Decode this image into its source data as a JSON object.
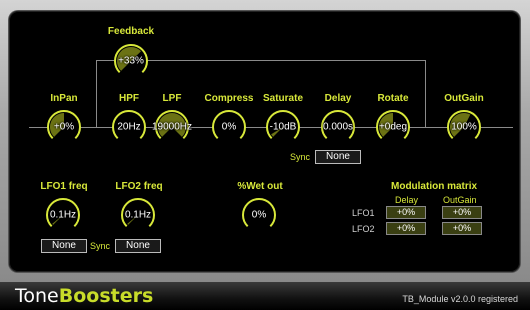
{
  "colors": {
    "accent": "#d8e83a",
    "knob_fill": "#6b7214",
    "knob_body": "#000000"
  },
  "knobs": {
    "feedback": {
      "label": "Feedback",
      "value": "+33%",
      "level": 0.67
    },
    "inpan": {
      "label": "InPan",
      "value": "+0%",
      "level": 0.5
    },
    "hpf": {
      "label": "HPF",
      "value": "20Hz",
      "level": 0.0
    },
    "lpf": {
      "label": "LPF",
      "value": "19000Hz",
      "level": 1.0
    },
    "compress": {
      "label": "Compress",
      "value": "0%",
      "level": 0.0
    },
    "saturate": {
      "label": "Saturate",
      "value": "-10dB",
      "level": 0.05
    },
    "delay": {
      "label": "Delay",
      "value": "0.000s",
      "level": 0.0
    },
    "rotate": {
      "label": "Rotate",
      "value": "+0deg",
      "level": 0.5
    },
    "outgain": {
      "label": "OutGain",
      "value": "100%",
      "level": 0.6
    },
    "lfo1": {
      "label": "LFO1 freq",
      "value": "0.1Hz",
      "level": 0.02
    },
    "lfo2": {
      "label": "LFO2 freq",
      "value": "0.1Hz",
      "level": 0.02
    },
    "wet": {
      "label": "%Wet out",
      "value": "0%",
      "level": 0.0
    }
  },
  "delay_sync": {
    "label": "Sync",
    "value": "None"
  },
  "lfo1_sync": {
    "value": "None"
  },
  "lfo2_sync": {
    "label": "Sync",
    "value": "None"
  },
  "matrix": {
    "title": "Modulation matrix",
    "col_delay": "Delay",
    "col_outgain": "OutGain",
    "rows": [
      {
        "name": "LFO1",
        "delay": "+0%",
        "outgain": "+0%"
      },
      {
        "name": "LFO2",
        "delay": "+0%",
        "outgain": "+0%"
      }
    ]
  },
  "footer": {
    "brand_a": "Tone",
    "brand_b": "Boosters",
    "version": "TB_Module v2.0.0 registered"
  }
}
